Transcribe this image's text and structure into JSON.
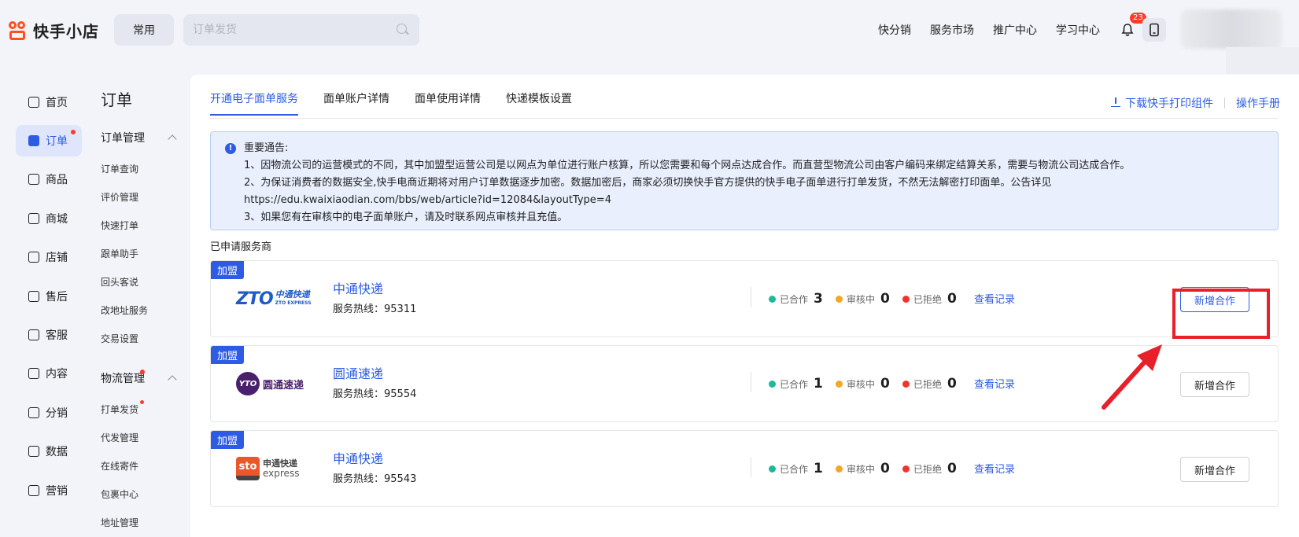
{
  "brand": {
    "name": "快手小店"
  },
  "header": {
    "common_label": "常用",
    "search_placeholder": "订单发货",
    "nav": [
      "快分销",
      "服务市场",
      "推广中心",
      "学习中心"
    ],
    "notification_count": "23"
  },
  "leftnav": [
    {
      "label": "首页",
      "icon": "home-icon"
    },
    {
      "label": "订单",
      "icon": "order-icon",
      "active": true
    },
    {
      "label": "商品",
      "icon": "product-icon"
    },
    {
      "label": "商城",
      "icon": "mall-icon"
    },
    {
      "label": "店铺",
      "icon": "store-icon"
    },
    {
      "label": "售后",
      "icon": "aftersale-icon"
    },
    {
      "label": "客服",
      "icon": "service-icon"
    },
    {
      "label": "内容",
      "icon": "content-icon"
    },
    {
      "label": "分销",
      "icon": "distribution-icon"
    },
    {
      "label": "数据",
      "icon": "data-icon"
    },
    {
      "label": "营销",
      "icon": "marketing-icon"
    }
  ],
  "subnav": {
    "title": "订单",
    "group1": "订单管理",
    "group1_items": [
      "订单查询",
      "评价管理",
      "快速打单",
      "跟单助手",
      "回头客说",
      "改地址服务",
      "交易设置"
    ],
    "group2": "物流管理",
    "group2_items": [
      "打单发货",
      "代发管理",
      "在线寄件",
      "包裹中心",
      "地址管理"
    ]
  },
  "tabs": [
    "开通电子面单服务",
    "面单账户详情",
    "面单使用详情",
    "快递模板设置"
  ],
  "toplinks": {
    "download": "下载快手打印组件",
    "manual": "操作手册"
  },
  "notice": {
    "title": "重要通告:",
    "lines": [
      "1、因物流公司的运营模式的不同，其中加盟型运营公司是以网点为单位进行账户核算，所以您需要和每个网点达成合作。而直营型物流公司由客户编码来绑定结算关系，需要与物流公司达成合作。",
      "2、为保证消费者的数据安全,快手电商近期将对用户订单数据逐步加密。数据加密后，商家必须切换快手官方提供的快手电子面单进行打单发货，不然无法解密打印面单。公告详见",
      "https://edu.kwaixiaodian.com/bbs/web/article?id=12084&layoutType=4",
      "3、如果您有在审核中的电子面单账户，请及时联系网点审核并且充值。"
    ]
  },
  "applied_label": "已申请服务商",
  "stat_labels": {
    "coop": "已合作",
    "review": "审核中",
    "rejected": "已拒绝"
  },
  "colors": {
    "coop": "#1fb99a",
    "review": "#f5a623",
    "rejected": "#f0342c",
    "accent": "#2d5be3"
  },
  "carriers": [
    {
      "tag": "加盟",
      "name": "中通快递",
      "hotline": "服务热线：95311",
      "logo_main": "ZTO",
      "logo_cn": "中通快递",
      "logo_sub": "ZTO EXPRESS",
      "coop": "3",
      "review": "0",
      "rejected": "0",
      "view": "查看记录",
      "add": "新增合作"
    },
    {
      "tag": "加盟",
      "name": "圆通速递",
      "hotline": "服务热线：95554",
      "logo_main": "YTO",
      "logo_cn": "圆通速递",
      "coop": "1",
      "review": "0",
      "rejected": "0",
      "view": "查看记录",
      "add": "新增合作"
    },
    {
      "tag": "加盟",
      "name": "申通快递",
      "hotline": "服务热线：95543",
      "logo_main": "sto",
      "logo_cn": "申通快递",
      "logo_sub": "express",
      "coop": "1",
      "review": "0",
      "rejected": "0",
      "view": "查看记录",
      "add": "新增合作"
    }
  ]
}
